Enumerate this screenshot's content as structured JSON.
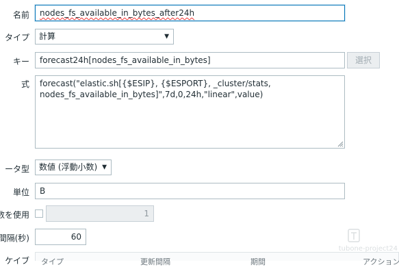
{
  "form": {
    "name": {
      "label": "名前",
      "value": "nodes_fs_available_in_bytes_after24h"
    },
    "type": {
      "label": "タイプ",
      "selected": "計算"
    },
    "key": {
      "label": "キー",
      "value": "forecast24h[nodes_fs_available_in_bytes]",
      "select_button": "選択"
    },
    "formula": {
      "label": "式",
      "line1": "forecast(\"elastic.sh[{$ESIP}, {$ESPORT}, _cluster/stats,",
      "line2": "nodes_fs_available_in_bytes]\",7d,0,24h,\"linear\",value)"
    },
    "data_type": {
      "label": "ータ型",
      "selected": "数値 (浮動小数)"
    },
    "units": {
      "label": "単位",
      "value": "B"
    },
    "multiplier": {
      "label": "数を使用",
      "checked": false,
      "value": "1"
    },
    "interval": {
      "label": "間隔(秒)",
      "value": "60"
    }
  },
  "table_header": {
    "row_label": "ケイブ",
    "columns": [
      "タイプ",
      "更新間隔",
      "期間",
      "アクション"
    ]
  },
  "watermark": {
    "text": "tubone-project24"
  },
  "colors": {
    "focus_border": "#0275b8",
    "border": "#acbbc2",
    "disabled_bg": "#ebeef0",
    "text": "#1f2c33"
  }
}
